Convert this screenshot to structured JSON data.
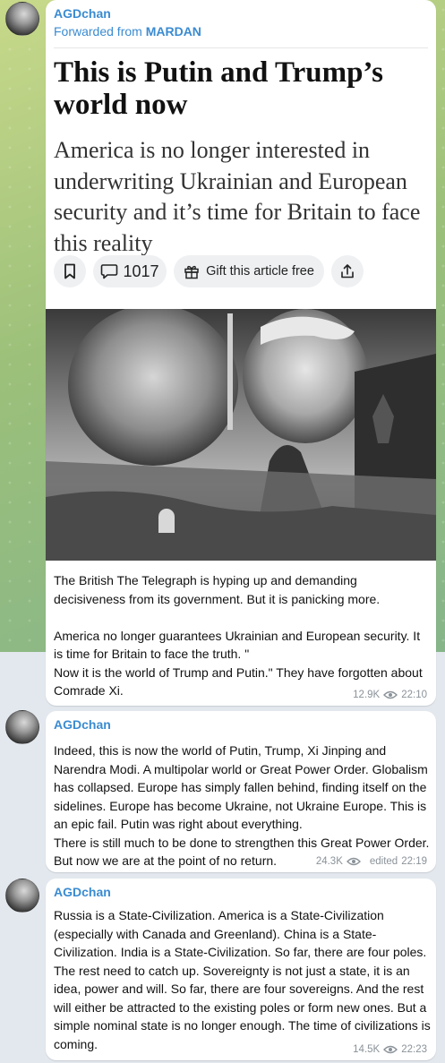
{
  "messages": [
    {
      "sender": "AGDchan",
      "forwarded_prefix": "Forwarded from",
      "forwarded_from": "MARDAN",
      "article": {
        "title": "This is Putin and Trump’s world now",
        "subtitle": "America is no longer interested in underwriting Ukrainian and European security and it’s time for Britain to face this reality",
        "comments_count": "1017",
        "gift_label": "Gift this article free"
      },
      "text": "The British The Telegraph is hyping up and demanding decisiveness from its government. But it is panicking more.\n\nAmerica no longer guarantees Ukrainian and European security. It is time for Britain to face the truth. \"\nNow it is the world of Trump and Putin.\" They have forgotten about Comrade Xi.",
      "views": "12.9K",
      "edited": "",
      "time": "22:10"
    },
    {
      "sender": "AGDchan",
      "text": "Indeed, this is now the world of Putin, Trump, Xi Jinping and Narendra Modi. A multipolar world or Great Power Order. Globalism has collapsed. Europe has simply fallen behind, finding itself on the sidelines. Europe has become Ukraine, not Ukraine Europe. This is an epic fail. Putin was right about everything.\nThere is still much to be done to strengthen this Great Power Order. But now we are at the point of no return.",
      "views": "24.3K",
      "edited": "edited",
      "time": "22:19"
    },
    {
      "sender": "AGDchan",
      "text": "Russia is a State-Civilization. America is a State-Civilization (especially with Canada and Greenland). China is a State-Civilization. India is a State-Civilization. So far, there are four poles. The rest need to catch up. Sovereignty is not just a state, it is an idea, power and will. So far, there are four sovereigns. And the rest will either be attracted to the existing poles or form new ones. But a simple nominal state is no longer enough. The time of civilizations is coming.",
      "views": "14.5K",
      "edited": "",
      "time": "22:23"
    }
  ]
}
